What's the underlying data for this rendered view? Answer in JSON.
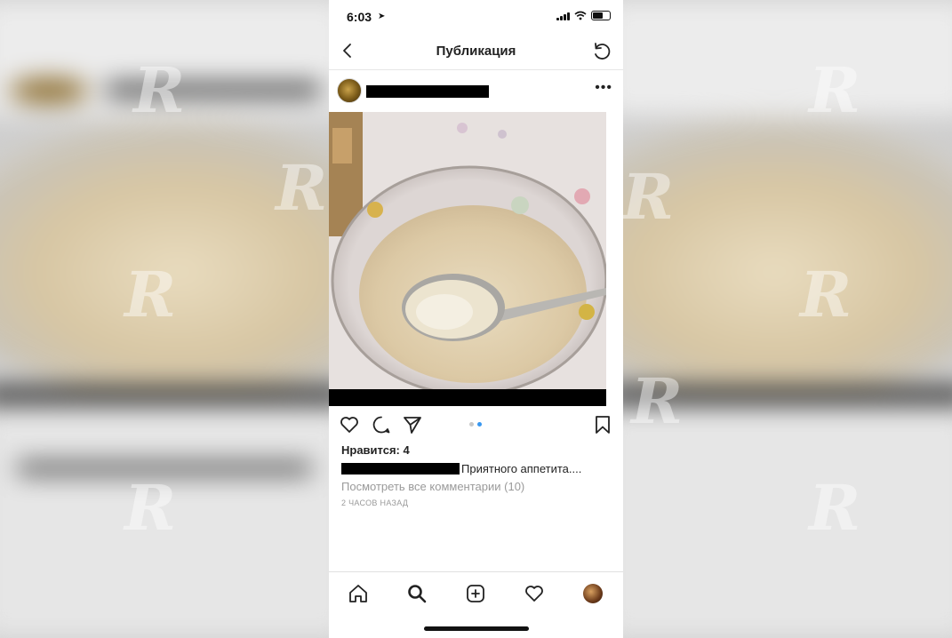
{
  "status_bar": {
    "time": "6:03",
    "location_icon": "location-arrow-icon",
    "signal_icon": "cellular-signal-icon",
    "wifi_icon": "wifi-icon",
    "battery_icon": "battery-icon"
  },
  "nav": {
    "title": "Публикация",
    "back_icon": "chevron-left-icon",
    "refresh_icon": "refresh-icon"
  },
  "post": {
    "more_icon": "more-horizontal-icon",
    "more_label": "•••",
    "likes": "Нравится: 4",
    "caption_text": "Приятного аппетита....",
    "view_comments": "Посмотреть все комментарии (10)",
    "time_ago": "2 ЧАСОВ НАЗАД",
    "carousel": {
      "count": 2,
      "active": 2
    }
  },
  "actions": {
    "like_icon": "heart-icon",
    "comment_icon": "comment-icon",
    "share_icon": "send-icon",
    "save_icon": "bookmark-icon"
  },
  "tabbar": {
    "items": [
      "home-icon",
      "search-icon",
      "add-post-icon",
      "activity-heart-icon",
      "profile-avatar"
    ]
  },
  "colors": {
    "accent": "#3897f0",
    "text": "#222222",
    "muted": "#9a9a9a"
  }
}
